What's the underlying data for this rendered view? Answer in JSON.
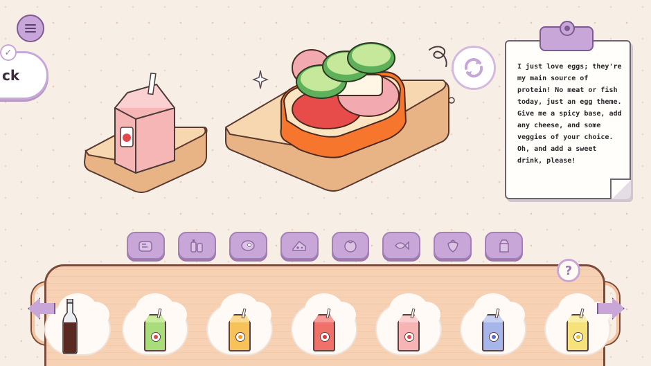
{
  "header": {
    "menu_icon": "hamburger-icon"
  },
  "back_bubble": {
    "label": "ck",
    "badge_icon": "checkmark-icon"
  },
  "order_note": {
    "text": "I just love eggs; they're my main source of protein! No meat or fish today, just an egg theme. Give me a spicy base, add any cheese, and some veggies of your choice. Oh, and add a sweet drink, please!"
  },
  "refresh": {
    "icon": "refresh-icon"
  },
  "help": {
    "label": "?"
  },
  "categories": [
    {
      "name": "bread",
      "icon": "bread-icon"
    },
    {
      "name": "sauces",
      "icon": "sauce-bottles-icon"
    },
    {
      "name": "meat",
      "icon": "steak-icon"
    },
    {
      "name": "cheese",
      "icon": "cheese-icon"
    },
    {
      "name": "vegetables",
      "icon": "tomato-icon"
    },
    {
      "name": "fish",
      "icon": "fish-icon"
    },
    {
      "name": "fruit",
      "icon": "strawberry-icon"
    },
    {
      "name": "drinks",
      "icon": "milk-carton-icon"
    }
  ],
  "drinks": [
    {
      "name": "cola-bottle",
      "kind": "bottle",
      "color": "#5a2a22"
    },
    {
      "name": "apple-juice",
      "kind": "carton",
      "color": "#a9dc7a",
      "fruit": "#d94a4a"
    },
    {
      "name": "orange-juice",
      "kind": "carton",
      "color": "#f8c25a",
      "fruit": "#f39c2a"
    },
    {
      "name": "tomato-juice",
      "kind": "carton",
      "color": "#f0706a",
      "fruit": "#d93b3b"
    },
    {
      "name": "strawberry-milk",
      "kind": "carton",
      "color": "#f7b4b4",
      "fruit": "#e0484c"
    },
    {
      "name": "blueberry-milk",
      "kind": "carton",
      "color": "#a7b6ea",
      "fruit": "#5b6cc8"
    },
    {
      "name": "banana-milk",
      "kind": "carton",
      "color": "#f6e27a",
      "fruit": "#e8c23a"
    }
  ],
  "colors": {
    "accent": "#c9a6d8",
    "accent_dark": "#7d5a92",
    "wood": "#f3c8a8",
    "background": "#f7efe6"
  }
}
